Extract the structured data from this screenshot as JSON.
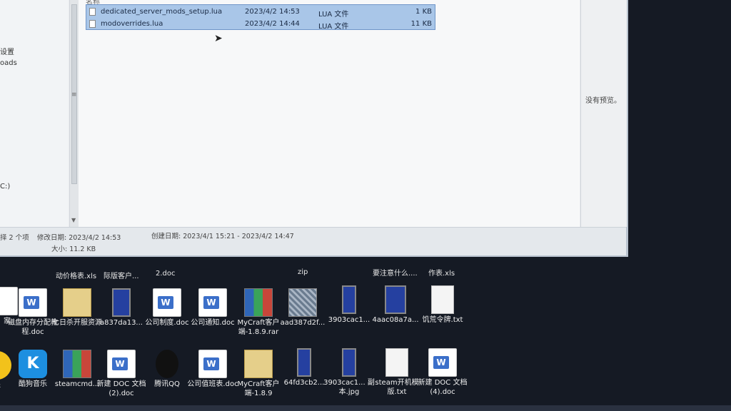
{
  "window": {
    "nav": {
      "items": [
        "设置",
        "oads",
        "C:)"
      ]
    },
    "list": {
      "col_name": "名称",
      "files": [
        {
          "name": "dedicated_server_mods_setup.lua",
          "date": "2023/4/2 14:53",
          "type": "LUA 文件",
          "size": "1 KB"
        },
        {
          "name": "modoverrides.lua",
          "date": "2023/4/2 14:44",
          "type": "LUA 文件",
          "size": "11 KB"
        }
      ]
    },
    "preview": {
      "message": "没有预览。"
    },
    "details": {
      "selected": "择 2 个项",
      "modified": "修改日期: 2023/4/2 14:53",
      "size": "大小: 11.2 KB",
      "created": "创建日期: 2023/4/1 15:21 - 2023/4/2 14:47"
    }
  },
  "desktop": {
    "top_row_labels": [
      "动价格表.xls",
      "际版客户...",
      "2.doc",
      "zip",
      "要注意什么....",
      "作表.xls"
    ],
    "row1": [
      {
        "label": "家",
        "icon": "doc-icon"
      },
      {
        "label": "磁盘内存分配教程.doc",
        "icon": "word-doc-icon"
      },
      {
        "label": "七日杀开服资源",
        "icon": "folder-icon"
      },
      {
        "label": "a837da13...",
        "icon": "phone-image-icon"
      },
      {
        "label": "公司制度.doc",
        "icon": "word-doc-icon"
      },
      {
        "label": "公司通知.doc",
        "icon": "word-doc-icon"
      },
      {
        "label": "MyCraft客户端-1.8.9.rar",
        "icon": "winrar-icon"
      },
      {
        "label": "aad387d2f...",
        "icon": "image-icon"
      },
      {
        "label": "3903cac1...",
        "icon": "phone-image-icon"
      },
      {
        "label": "4aac08a7a...",
        "icon": "phone-image-icon"
      },
      {
        "label": "饥荒令牌.txt",
        "icon": "text-file-icon"
      }
    ],
    "row2": [
      {
        "label": "乐",
        "icon": "yellow-app-icon"
      },
      {
        "label": "酷狗音乐",
        "icon": "kugou-icon"
      },
      {
        "label": "steamcmd...",
        "icon": "winrar-icon"
      },
      {
        "label": "新建 DOC 文档 (2).doc",
        "icon": "word-doc-icon"
      },
      {
        "label": "腾讯QQ",
        "icon": "qq-icon"
      },
      {
        "label": "公司值班表.doc",
        "icon": "word-doc-icon"
      },
      {
        "label": "MyCraft客户端-1.8.9",
        "icon": "folder-icon"
      },
      {
        "label": "64fd3cb2...",
        "icon": "phone-image-icon"
      },
      {
        "label": "3903cac1... 副本.jpg",
        "icon": "phone-image-icon"
      },
      {
        "label": "steam开机模版.txt",
        "icon": "text-file-icon"
      },
      {
        "label": "新建 DOC 文档 (4).doc",
        "icon": "word-doc-icon"
      }
    ]
  }
}
